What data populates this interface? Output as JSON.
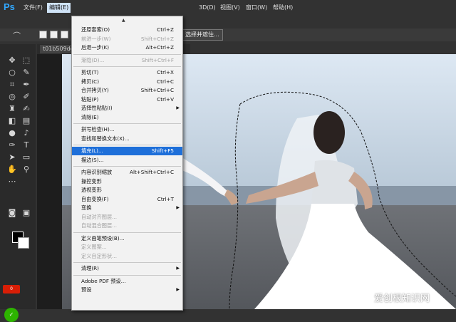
{
  "app": {
    "logo": "Ps"
  },
  "menubar": [
    {
      "label": "文件(F)"
    },
    {
      "label": "编辑(E)"
    },
    {
      "label": "3D(D)"
    },
    {
      "label": "视图(V)"
    },
    {
      "label": "窗口(W)"
    },
    {
      "label": "帮助(H)"
    }
  ],
  "options": {
    "select_mask": "选择并遮住..."
  },
  "document_tab": {
    "label": "t01b509dc0"
  },
  "edit_menu": {
    "scroll_indicator": "▲",
    "items": [
      {
        "label": "还原套索(O)",
        "shortcut": "Ctrl+Z",
        "disabled": false
      },
      {
        "label": "前进一步(W)",
        "shortcut": "Shift+Ctrl+Z",
        "disabled": true
      },
      {
        "label": "后退一步(K)",
        "shortcut": "Alt+Ctrl+Z",
        "disabled": false
      },
      {
        "sep": true
      },
      {
        "label": "渐隐(D)...",
        "shortcut": "Shift+Ctrl+F",
        "disabled": true
      },
      {
        "sep": true
      },
      {
        "label": "剪切(T)",
        "shortcut": "Ctrl+X",
        "disabled": false
      },
      {
        "label": "拷贝(C)",
        "shortcut": "Ctrl+C",
        "disabled": false
      },
      {
        "label": "合并拷贝(Y)",
        "shortcut": "Shift+Ctrl+C",
        "disabled": false
      },
      {
        "label": "粘贴(P)",
        "shortcut": "Ctrl+V",
        "disabled": false
      },
      {
        "label": "选择性粘贴(I)",
        "shortcut": "",
        "submenu": true,
        "disabled": false
      },
      {
        "label": "清除(E)",
        "shortcut": "",
        "disabled": false
      },
      {
        "sep": true
      },
      {
        "label": "拼写检查(H)...",
        "shortcut": "",
        "disabled": false
      },
      {
        "label": "查找和替换文本(X)...",
        "shortcut": "",
        "disabled": false
      },
      {
        "sep": true
      },
      {
        "label": "填充(L)...",
        "shortcut": "Shift+F5",
        "disabled": false,
        "highlight": true
      },
      {
        "label": "描边(S)...",
        "shortcut": "",
        "disabled": false
      },
      {
        "sep": true
      },
      {
        "label": "内容识别缩放",
        "shortcut": "Alt+Shift+Ctrl+C",
        "disabled": false
      },
      {
        "label": "操控变形",
        "shortcut": "",
        "disabled": false
      },
      {
        "label": "透视变形",
        "shortcut": "",
        "disabled": false
      },
      {
        "label": "自由变换(F)",
        "shortcut": "Ctrl+T",
        "disabled": false
      },
      {
        "label": "变换",
        "shortcut": "",
        "submenu": true,
        "disabled": false
      },
      {
        "label": "自动对齐图层...",
        "shortcut": "",
        "disabled": true
      },
      {
        "label": "自动混合图层...",
        "shortcut": "",
        "disabled": true
      },
      {
        "sep": true
      },
      {
        "label": "定义画笔预设(B)...",
        "shortcut": "",
        "disabled": false
      },
      {
        "label": "定义图案...",
        "shortcut": "",
        "disabled": true
      },
      {
        "label": "定义自定形状...",
        "shortcut": "",
        "disabled": true
      },
      {
        "sep": true
      },
      {
        "label": "清理(R)",
        "shortcut": "",
        "submenu": true,
        "disabled": false
      },
      {
        "sep": true
      },
      {
        "label": "Adobe PDF 预设...",
        "shortcut": "",
        "disabled": false
      },
      {
        "label": "预设",
        "shortcut": "",
        "submenu": true,
        "disabled": false
      }
    ]
  },
  "badges": {
    "red": "0",
    "green": "✓"
  },
  "watermark": "爱创根知识网",
  "colors": {
    "accent": "#1e6fd9",
    "menu_bg": "#f2f2f2",
    "ps_blue": "#31a8ff"
  }
}
